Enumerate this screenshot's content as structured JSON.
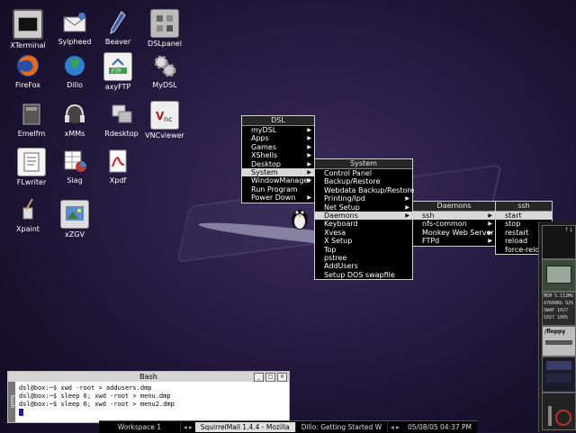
{
  "desktop": {
    "icons": [
      {
        "label": "XTerminal",
        "icon": "terminal-icon"
      },
      {
        "label": "Sylpheed",
        "icon": "mail-icon"
      },
      {
        "label": "Beaver",
        "icon": "pen-icon"
      },
      {
        "label": "DSLpanel",
        "icon": "control-panel-icon"
      },
      {
        "label": "FireFox",
        "icon": "firefox-icon"
      },
      {
        "label": "Dillo",
        "icon": "globe-icon"
      },
      {
        "label": "axyFTP",
        "icon": "ftp-icon"
      },
      {
        "label": "MyDSL",
        "icon": "gears-icon"
      },
      {
        "label": "Emelfm",
        "icon": "file-manager-icon"
      },
      {
        "label": "xMMs",
        "icon": "headphones-icon"
      },
      {
        "label": "Rdesktop",
        "icon": "remote-desktop-icon"
      },
      {
        "label": "VNCviewer",
        "icon": "vnc-icon"
      },
      {
        "label": "FLwriter",
        "icon": "document-icon"
      },
      {
        "label": "Siag",
        "icon": "spreadsheet-icon"
      },
      {
        "label": "Xpdf",
        "icon": "pdf-icon"
      },
      {
        "label": "Xpaint",
        "icon": "paint-icon"
      },
      {
        "label": "xZGV",
        "icon": "image-viewer-icon"
      }
    ]
  },
  "menus": {
    "dsl": {
      "title": "DSL",
      "items": [
        "myDSL",
        "Apps",
        "Games",
        "XShells",
        "Desktop",
        "System",
        "WindowManager",
        "Run Program",
        "Power Down"
      ]
    },
    "system": {
      "title": "System",
      "items": [
        "Control Panel",
        "Backup/Restore",
        "Webdata Backup/Restore",
        "Printing/lpd",
        "Net Setup",
        "Daemons",
        "Keyboard",
        "Xvesa",
        "X Setup",
        "Top",
        "pstree",
        "AddUsers",
        "Setup DOS swapfile"
      ]
    },
    "daemons": {
      "title": "Daemons",
      "items": [
        "ssh",
        "nfs-common",
        "Monkey Web Server",
        "FTPd"
      ]
    },
    "ssh": {
      "title": "ssh",
      "items": [
        "start",
        "stop",
        "restart",
        "reload",
        "force-reload"
      ]
    }
  },
  "terminal": {
    "title": "Bash",
    "side_label": "bash",
    "lines": [
      "dsl@box:~$ xwd -root > addusers.dmp",
      "dsl@box:~$ sleep 6; xwd -root > menu.dmp",
      "dsl@box:~$ sleep 6; xwd -root > menu2.dmp"
    ]
  },
  "taskbar": {
    "workspace": "Workspace 1",
    "tasks": [
      "SquirrelMail 1.4.4 - Mozilla",
      "Dillo: Getting Started W"
    ],
    "clock": "05/08/05 04:37 PM"
  },
  "monitor": {
    "sys_lines": [
      "MEM 5.152Mb",
      "47600Kb 92%",
      "SWAP 1027",
      "1027 100%"
    ],
    "floppy_label": "/floppy"
  }
}
